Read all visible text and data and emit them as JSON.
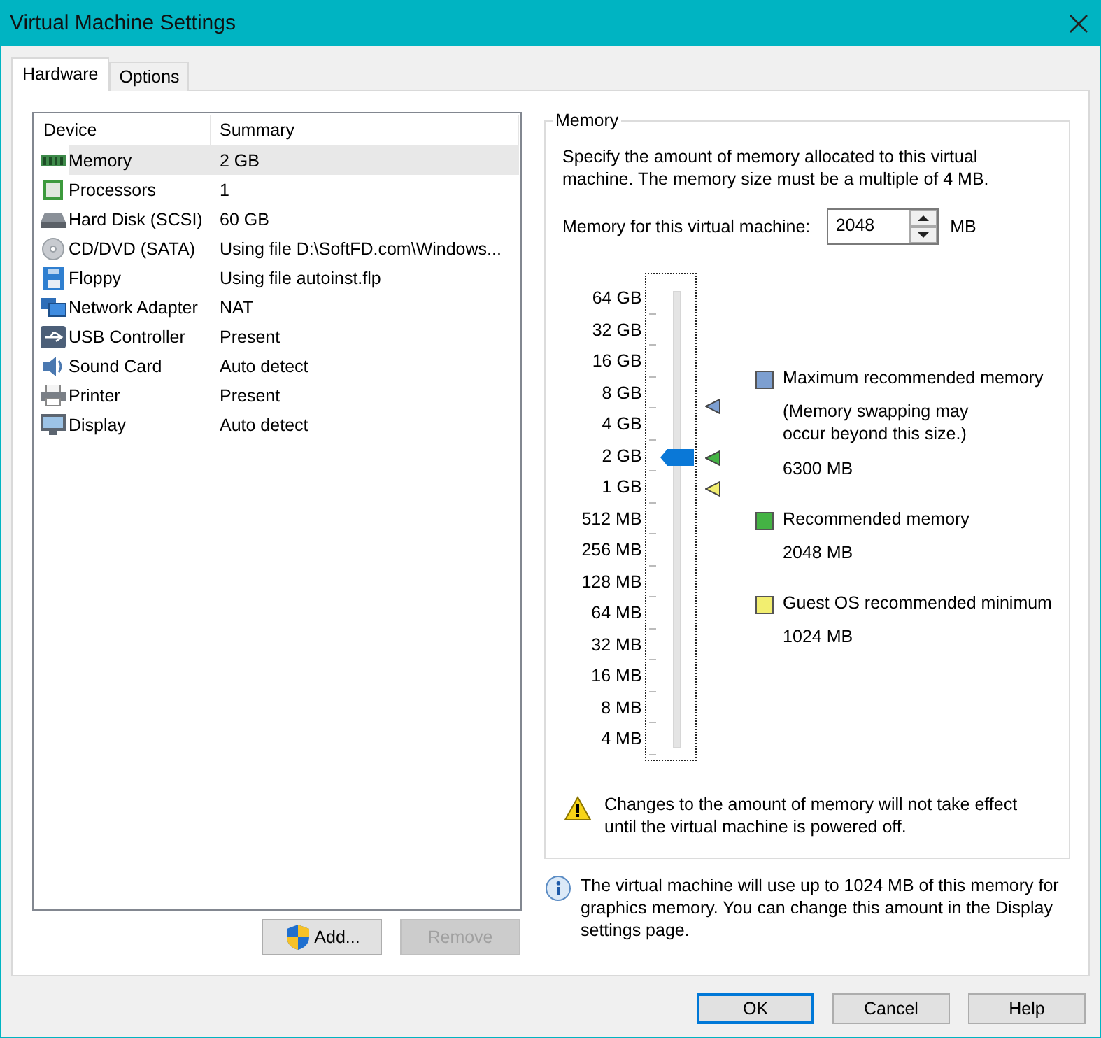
{
  "window": {
    "title": "Virtual Machine Settings"
  },
  "tabs": [
    {
      "label": "Hardware",
      "selected": true
    },
    {
      "label": "Options",
      "selected": false
    }
  ],
  "devices": {
    "columns": [
      "Device",
      "Summary"
    ],
    "rows": [
      {
        "kind": "memory",
        "device": "Memory",
        "summary": "2 GB",
        "selected": true
      },
      {
        "kind": "processor",
        "device": "Processors",
        "summary": "1",
        "selected": false
      },
      {
        "kind": "disk",
        "device": "Hard Disk (SCSI)",
        "summary": "60 GB",
        "selected": false
      },
      {
        "kind": "cd",
        "device": "CD/DVD (SATA)",
        "summary": "Using file D:\\SoftFD.com\\Windows...",
        "selected": false
      },
      {
        "kind": "floppy",
        "device": "Floppy",
        "summary": "Using file autoinst.flp",
        "selected": false
      },
      {
        "kind": "network",
        "device": "Network Adapter",
        "summary": "NAT",
        "selected": false
      },
      {
        "kind": "usb",
        "device": "USB Controller",
        "summary": "Present",
        "selected": false
      },
      {
        "kind": "sound",
        "device": "Sound Card",
        "summary": "Auto detect",
        "selected": false
      },
      {
        "kind": "printer",
        "device": "Printer",
        "summary": "Present",
        "selected": false
      },
      {
        "kind": "display",
        "device": "Display",
        "summary": "Auto detect",
        "selected": false
      }
    ]
  },
  "device_buttons": [
    {
      "label": "Add...",
      "kind": "shield",
      "disabled": false
    },
    {
      "label": "Remove",
      "kind": "plain",
      "disabled": true
    }
  ],
  "memory": {
    "title": "Memory",
    "description": "Specify the amount of memory allocated to this virtual machine. The memory size must be a multiple of 4 MB.",
    "field_label": "Memory for this virtual machine:",
    "value": "2048",
    "unit": "MB",
    "scale": [
      "64 GB",
      "32 GB",
      "16 GB",
      "8 GB",
      "4 GB",
      "2 GB",
      "1 GB",
      "512 MB",
      "256 MB",
      "128 MB",
      "64 MB",
      "32 MB",
      "16 MB",
      "8 MB",
      "4 MB"
    ],
    "slider": {
      "level": 0.643
    },
    "markers": [
      {
        "label": "Maximum recommended memory",
        "note": "(Memory swapping may occur beyond this size.)",
        "value": "6300 MB",
        "color": "#7d9fd0"
      },
      {
        "label": "Recommended memory",
        "value": "2048 MB",
        "color": "#44b344"
      },
      {
        "label": "Guest OS recommended minimum",
        "value": "1024 MB",
        "color": "#f2ee70"
      }
    ],
    "warning": "Changes to the amount of memory will not take effect until the virtual machine is powered off."
  },
  "info": "The virtual machine will use up to 1024 MB of this memory for graphics memory. You can change this amount in the Display settings page.",
  "dialog_buttons": [
    {
      "label": "OK",
      "default": true
    },
    {
      "label": "Cancel",
      "default": false
    },
    {
      "label": "Help",
      "default": false
    }
  ]
}
